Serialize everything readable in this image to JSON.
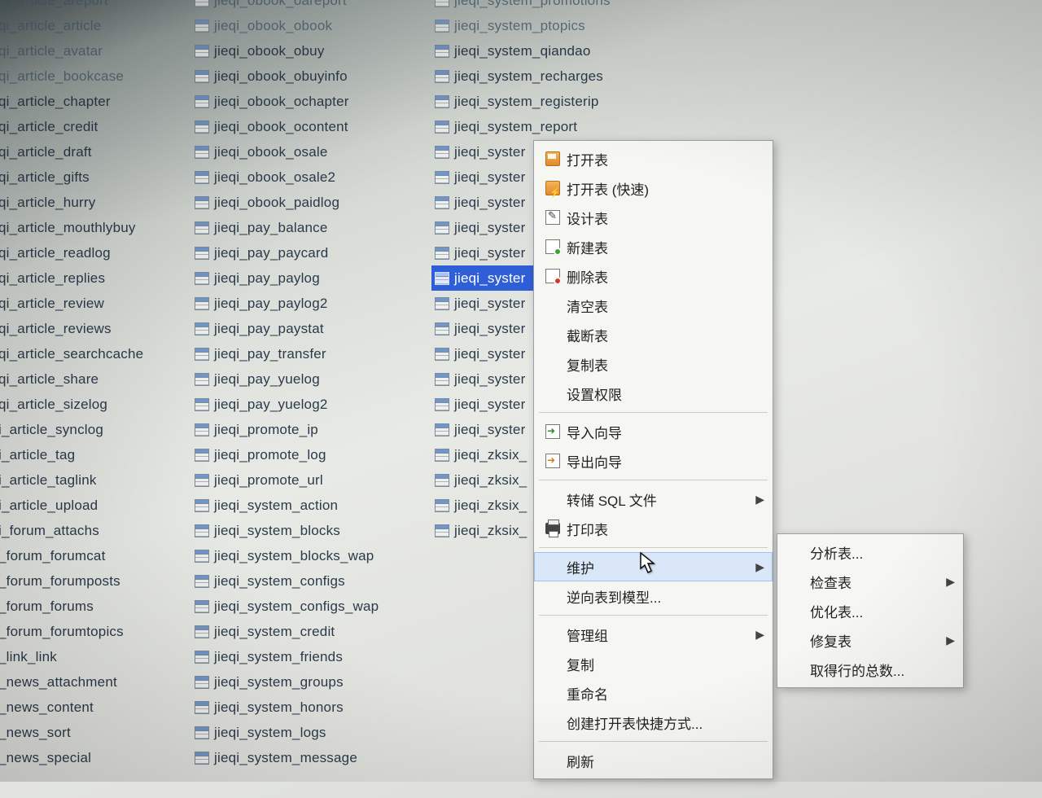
{
  "columns": {
    "a": [
      {
        "label": "qi_article_areport",
        "faded": true
      },
      {
        "label": "qi_article_article",
        "faded": true
      },
      {
        "label": "qi_article_avatar",
        "faded": true
      },
      {
        "label": "qi_article_bookcase",
        "faded": true
      },
      {
        "label": "qi_article_chapter"
      },
      {
        "label": "qi_article_credit"
      },
      {
        "label": "qi_article_draft"
      },
      {
        "label": "qi_article_gifts"
      },
      {
        "label": "qi_article_hurry"
      },
      {
        "label": "qi_article_mouthlybuy"
      },
      {
        "label": "qi_article_readlog"
      },
      {
        "label": "qi_article_replies"
      },
      {
        "label": "qi_article_review"
      },
      {
        "label": "qi_article_reviews"
      },
      {
        "label": "qi_article_searchcache"
      },
      {
        "label": "qi_article_share"
      },
      {
        "label": "qi_article_sizelog"
      },
      {
        "label": "i_article_synclog"
      },
      {
        "label": "i_article_tag"
      },
      {
        "label": "i_article_taglink"
      },
      {
        "label": "i_article_upload"
      },
      {
        "label": "i_forum_attachs"
      },
      {
        "label": "_forum_forumcat"
      },
      {
        "label": "_forum_forumposts"
      },
      {
        "label": "_forum_forums"
      },
      {
        "label": "_forum_forumtopics"
      },
      {
        "label": "_link_link"
      },
      {
        "label": "_news_attachment"
      },
      {
        "label": "_news_content"
      },
      {
        "label": "_news_sort"
      },
      {
        "label": "_news_special"
      }
    ],
    "b": [
      {
        "label": "jieqi_obook_oareport",
        "faded": true
      },
      {
        "label": "jieqi_obook_obook",
        "faded": true
      },
      {
        "label": "jieqi_obook_obuy"
      },
      {
        "label": "jieqi_obook_obuyinfo"
      },
      {
        "label": "jieqi_obook_ochapter"
      },
      {
        "label": "jieqi_obook_ocontent"
      },
      {
        "label": "jieqi_obook_osale"
      },
      {
        "label": "jieqi_obook_osale2"
      },
      {
        "label": "jieqi_obook_paidlog"
      },
      {
        "label": "jieqi_pay_balance"
      },
      {
        "label": "jieqi_pay_paycard"
      },
      {
        "label": "jieqi_pay_paylog"
      },
      {
        "label": "jieqi_pay_paylog2"
      },
      {
        "label": "jieqi_pay_paystat"
      },
      {
        "label": "jieqi_pay_transfer"
      },
      {
        "label": "jieqi_pay_yuelog"
      },
      {
        "label": "jieqi_pay_yuelog2"
      },
      {
        "label": "jieqi_promote_ip"
      },
      {
        "label": "jieqi_promote_log"
      },
      {
        "label": "jieqi_promote_url"
      },
      {
        "label": "jieqi_system_action"
      },
      {
        "label": "jieqi_system_blocks"
      },
      {
        "label": "jieqi_system_blocks_wap"
      },
      {
        "label": "jieqi_system_configs"
      },
      {
        "label": "jieqi_system_configs_wap"
      },
      {
        "label": "jieqi_system_credit"
      },
      {
        "label": "jieqi_system_friends"
      },
      {
        "label": "jieqi_system_groups"
      },
      {
        "label": "jieqi_system_honors"
      },
      {
        "label": "jieqi_system_logs"
      },
      {
        "label": "jieqi_system_message"
      }
    ],
    "c": [
      {
        "label": "jieqi_system_promotions",
        "faded": true
      },
      {
        "label": "jieqi_system_ptopics",
        "faded": true
      },
      {
        "label": "jieqi_system_qiandao"
      },
      {
        "label": "jieqi_system_recharges"
      },
      {
        "label": "jieqi_system_registerip"
      },
      {
        "label": "jieqi_system_report"
      },
      {
        "label": "jieqi_syster"
      },
      {
        "label": "jieqi_syster"
      },
      {
        "label": "jieqi_syster"
      },
      {
        "label": "jieqi_syster"
      },
      {
        "label": "jieqi_syster"
      },
      {
        "label": "jieqi_syster",
        "selected": true
      },
      {
        "label": "jieqi_syster"
      },
      {
        "label": "jieqi_syster"
      },
      {
        "label": "jieqi_syster"
      },
      {
        "label": "jieqi_syster"
      },
      {
        "label": "jieqi_syster"
      },
      {
        "label": "jieqi_syster"
      },
      {
        "label": "jieqi_zksix_"
      },
      {
        "label": "jieqi_zksix_"
      },
      {
        "label": "jieqi_zksix_"
      },
      {
        "label": "jieqi_zksix_"
      }
    ]
  },
  "context_menu": [
    {
      "type": "item",
      "label": "打开表",
      "icon": "open"
    },
    {
      "type": "item",
      "label": "打开表 (快速)",
      "icon": "open2"
    },
    {
      "type": "item",
      "label": "设计表",
      "icon": "design"
    },
    {
      "type": "item",
      "label": "新建表",
      "icon": "new"
    },
    {
      "type": "item",
      "label": "删除表",
      "icon": "delete"
    },
    {
      "type": "item",
      "label": "清空表"
    },
    {
      "type": "item",
      "label": "截断表"
    },
    {
      "type": "item",
      "label": "复制表"
    },
    {
      "type": "item",
      "label": "设置权限"
    },
    {
      "type": "sep"
    },
    {
      "type": "item",
      "label": "导入向导",
      "icon": "import"
    },
    {
      "type": "item",
      "label": "导出向导",
      "icon": "export"
    },
    {
      "type": "sep"
    },
    {
      "type": "item",
      "label": "转储 SQL 文件",
      "submenu": true
    },
    {
      "type": "item",
      "label": "打印表",
      "icon": "print"
    },
    {
      "type": "sep"
    },
    {
      "type": "item",
      "label": "维护",
      "submenu": true,
      "hovered": true
    },
    {
      "type": "item",
      "label": "逆向表到模型..."
    },
    {
      "type": "sep"
    },
    {
      "type": "item",
      "label": "管理组",
      "submenu": true
    },
    {
      "type": "item",
      "label": "复制"
    },
    {
      "type": "item",
      "label": "重命名"
    },
    {
      "type": "item",
      "label": "创建打开表快捷方式..."
    },
    {
      "type": "sep"
    },
    {
      "type": "item",
      "label": "刷新"
    }
  ],
  "submenu": [
    {
      "type": "item",
      "label": "分析表..."
    },
    {
      "type": "item",
      "label": "检查表",
      "submenu": true
    },
    {
      "type": "item",
      "label": "优化表..."
    },
    {
      "type": "item",
      "label": "修复表",
      "submenu": true
    },
    {
      "type": "item",
      "label": "取得行的总数..."
    }
  ]
}
